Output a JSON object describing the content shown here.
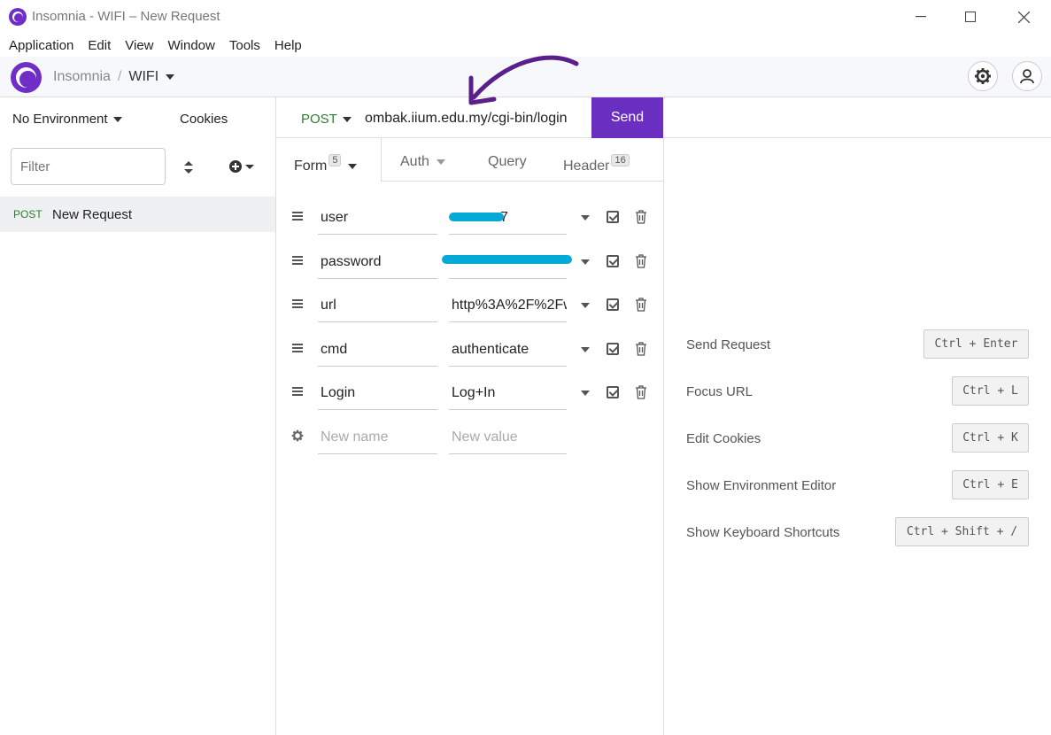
{
  "window": {
    "title": "Insomnia - WIFI – New Request"
  },
  "menu": [
    "Application",
    "Edit",
    "View",
    "Window",
    "Tools",
    "Help"
  ],
  "header": {
    "app": "Insomnia",
    "sep": "/",
    "workspace": "WIFI"
  },
  "sidebar": {
    "environment": "No Environment",
    "cookies": "Cookies",
    "filter_placeholder": "Filter",
    "request": {
      "method": "POST",
      "name": "New Request"
    }
  },
  "request": {
    "method": "POST",
    "url": "ombak.iium.edu.my/cgi-bin/login",
    "send_label": "Send"
  },
  "tabs": {
    "form": {
      "label": "Form",
      "count": "5"
    },
    "auth": {
      "label": "Auth"
    },
    "query": {
      "label": "Query"
    },
    "header": {
      "label": "Header",
      "count": "16"
    }
  },
  "form": {
    "rows": [
      {
        "name": "user",
        "value": "7"
      },
      {
        "name": "password",
        "value": ""
      },
      {
        "name": "url",
        "value": "http%3A%2F%2Fw"
      },
      {
        "name": "cmd",
        "value": "authenticate"
      },
      {
        "name": "Login",
        "value": "Log+In"
      }
    ],
    "new_name_placeholder": "New name",
    "new_value_placeholder": "New value"
  },
  "shortcuts": [
    {
      "label": "Send Request",
      "key": "Ctrl + Enter"
    },
    {
      "label": "Focus URL",
      "key": "Ctrl + L"
    },
    {
      "label": "Edit Cookies",
      "key": "Ctrl + K"
    },
    {
      "label": "Show Environment Editor",
      "key": "Ctrl + E"
    },
    {
      "label": "Show Keyboard Shortcuts",
      "key": "Ctrl + Shift + /"
    }
  ],
  "colors": {
    "accent": "#6a2fc0",
    "method_post": "#2e7d32",
    "redaction": "#06a9d6"
  }
}
